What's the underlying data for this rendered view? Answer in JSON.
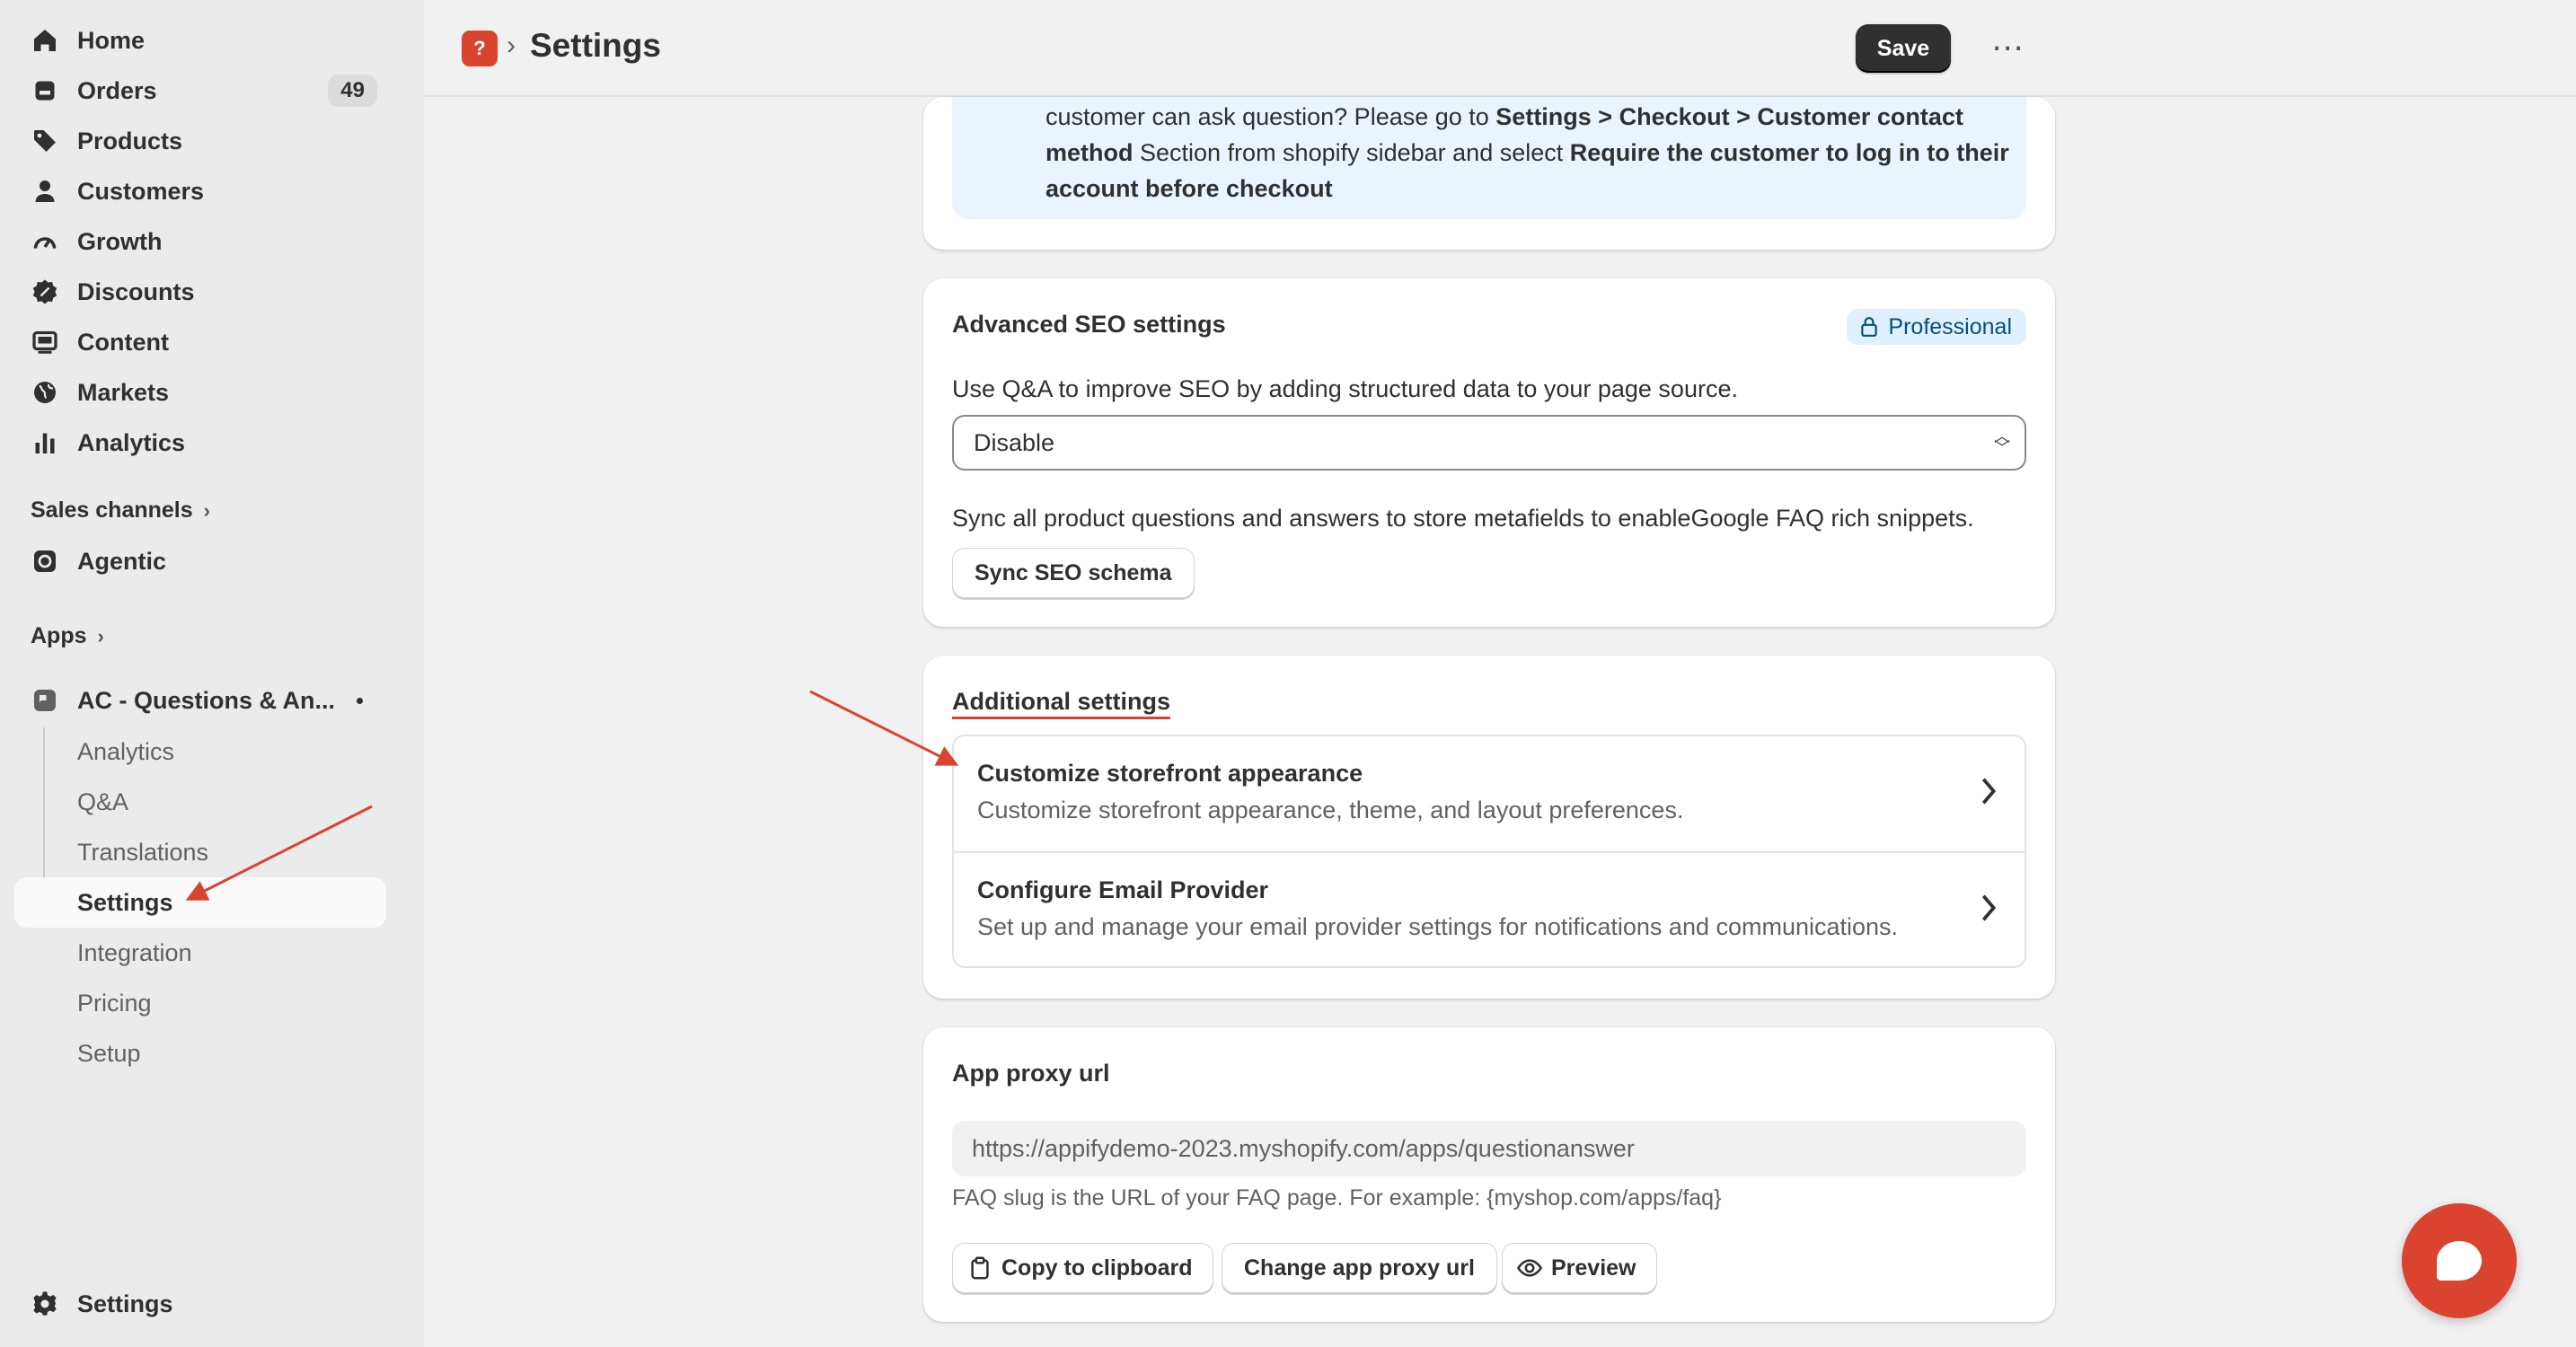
{
  "sidebar": {
    "items": [
      {
        "label": "Home",
        "icon": "home-icon"
      },
      {
        "label": "Orders",
        "icon": "orders-icon",
        "badge": "49"
      },
      {
        "label": "Products",
        "icon": "tag-icon"
      },
      {
        "label": "Customers",
        "icon": "person-icon"
      },
      {
        "label": "Growth",
        "icon": "gauge-icon"
      },
      {
        "label": "Discounts",
        "icon": "discount-icon"
      },
      {
        "label": "Content",
        "icon": "content-icon"
      },
      {
        "label": "Markets",
        "icon": "globe-icon"
      },
      {
        "label": "Analytics",
        "icon": "bar-chart-icon"
      }
    ],
    "sales_channels_label": "Sales channels",
    "agentic_label": "Agentic",
    "apps_label": "Apps",
    "app_name": "AC - Questions & An...",
    "app_sub_items": [
      "Analytics",
      "Q&A",
      "Translations",
      "Settings",
      "Integration",
      "Pricing",
      "Setup"
    ],
    "active_sub_item": "Settings",
    "settings_label": "Settings"
  },
  "header": {
    "title": "Settings",
    "save_label": "Save",
    "more_label": "⋯"
  },
  "info_card": {
    "line1_prefix": "customer can ask question? Please go to ",
    "line1_bold": "Settings > Checkout > Customer contact",
    "line2_bold": "method",
    "line2_text": " Section from shopify sidebar and select ",
    "line2_bold2": "Require the customer to log in to their",
    "line3_bold": "account before checkout"
  },
  "seo_card": {
    "title": "Advanced SEO settings",
    "badge": "Professional",
    "description": "Use Q&A to improve SEO by adding structured data to your page source.",
    "select_value": "Disable",
    "sync_description": "Sync all product questions and answers to store metafields to enableGoogle FAQ rich snippets.",
    "sync_button": "Sync SEO schema"
  },
  "additional_card": {
    "title": "Additional settings",
    "rows": [
      {
        "title": "Customize storefront appearance",
        "subtitle": "Customize storefront appearance, theme, and layout preferences."
      },
      {
        "title": "Configure Email Provider",
        "subtitle": "Set up and manage your email provider settings for notifications and communications."
      }
    ]
  },
  "proxy_card": {
    "title": "App proxy url",
    "url": "https://appifydemo-2023.myshopify.com/apps/questionanswer",
    "hint": "FAQ slug is the URL of your FAQ page. For example: {myshop.com/apps/faq}",
    "copy_button": "Copy to clipboard",
    "change_button": "Change app proxy url",
    "preview_button": "Preview"
  },
  "colors": {
    "accent": "#d9432f",
    "save_button": "#303030",
    "info_background": "#eaf4ff",
    "badge_background": "#e0f0ff"
  }
}
